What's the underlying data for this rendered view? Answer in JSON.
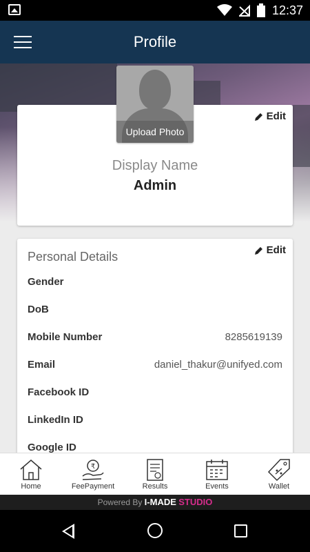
{
  "status_bar": {
    "time": "12:37"
  },
  "app_bar": {
    "title": "Profile"
  },
  "profile_card": {
    "upload_photo_label": "Upload Photo",
    "edit_label": "Edit",
    "display_name_label": "Display Name",
    "display_name_value": "Admin"
  },
  "personal_details": {
    "title": "Personal Details",
    "edit_label": "Edit",
    "rows": [
      {
        "label": "Gender",
        "value": ""
      },
      {
        "label": "DoB",
        "value": ""
      },
      {
        "label": "Mobile Number",
        "value": "8285619139"
      },
      {
        "label": "Email",
        "value": "daniel_thakur@unifyed.com"
      },
      {
        "label": "Facebook ID",
        "value": ""
      },
      {
        "label": "LinkedIn ID",
        "value": ""
      },
      {
        "label": "Google ID",
        "value": ""
      }
    ]
  },
  "bottom_nav": {
    "items": [
      {
        "label": "Home",
        "icon": "home-icon"
      },
      {
        "label": "FeePayment",
        "icon": "rupee-hand-icon"
      },
      {
        "label": "Results",
        "icon": "certificate-icon"
      },
      {
        "label": "Events",
        "icon": "calendar-icon"
      },
      {
        "label": "Wallet",
        "icon": "tag-icon"
      }
    ]
  },
  "footer": {
    "powered_by": "Powered By",
    "brand": "I-MADE",
    "brand_suffix": "STUDIO"
  },
  "colors": {
    "app_bar": "#153552",
    "brand_accent": "#d62d8c"
  }
}
